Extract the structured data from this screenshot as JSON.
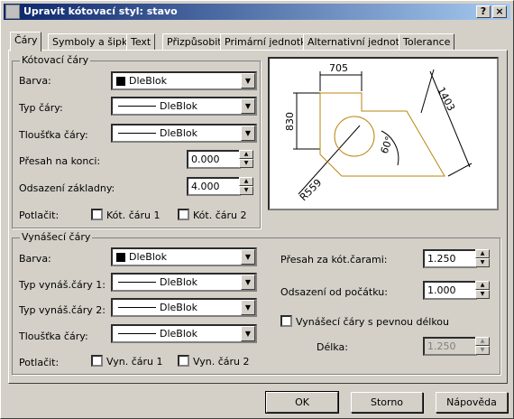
{
  "window": {
    "title": "Upravit kótovací styl: stavo",
    "help_btn": "?",
    "close_btn": "×"
  },
  "tabs": [
    "Čáry",
    "Symboly a šipky",
    "Text",
    "Přizpůsobit",
    "Primární jednotky",
    "Alternativní jednotky",
    "Tolerance"
  ],
  "dim_lines": {
    "group_label": "Kótovací čáry",
    "color_label": "Barva:",
    "color_value": "DleBlok",
    "linetype_label": "Typ čáry:",
    "linetype_value": "DleBlok",
    "lineweight_label": "Tloušťka čáry:",
    "lineweight_value": "DleBlok",
    "extend_label": "Přesah na konci:",
    "extend_value": "0.000",
    "baseline_label": "Odsazení základny:",
    "baseline_value": "4.000",
    "suppress_label": "Potlačit:",
    "suppress1": "Kót. čáru 1",
    "suppress2": "Kót. čáru 2"
  },
  "ext_lines": {
    "group_label": "Vynášecí čáry",
    "color_label": "Barva:",
    "color_value": "DleBlok",
    "lt1_label": "Typ vynáš.čáry 1:",
    "lt1_value": "DleBlok",
    "lt2_label": "Typ vynáš.čáry 2:",
    "lt2_value": "DleBlok",
    "lw_label": "Tloušťka čáry:",
    "lw_value": "DleBlok",
    "suppress_label": "Potlačit:",
    "suppress1": "Vyn. čáru 1",
    "suppress2": "Vyn. čáru 2",
    "beyond_label": "Přesah za kót.čarami:",
    "beyond_value": "1.250",
    "offset_label": "Odsazení od počátku:",
    "offset_value": "1.000",
    "fixed_label": "Vynášecí čáry s pevnou délkou",
    "length_label": "Délka:",
    "length_value": "1.250"
  },
  "preview": {
    "d1": "705",
    "d2": "830",
    "d3": "1403",
    "angle": "60°",
    "radius": "R559"
  },
  "buttons": {
    "ok": "OK",
    "cancel": "Storno",
    "help": "Nápověda"
  }
}
